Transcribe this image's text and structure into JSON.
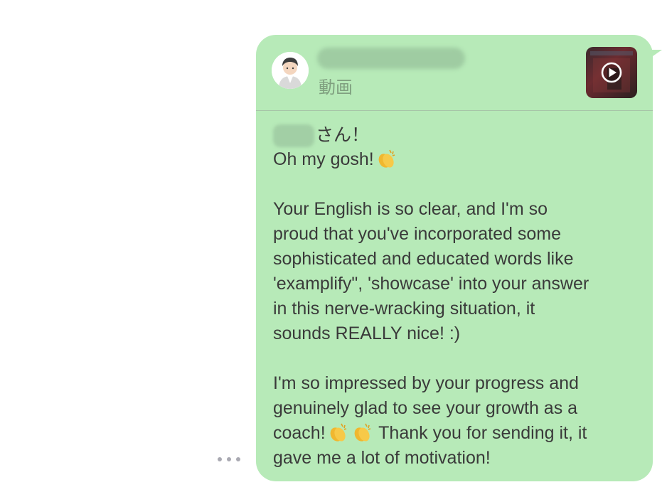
{
  "reply_preview": {
    "media_type_label": "動画",
    "icons": {
      "avatar": "person-avatar-icon",
      "thumbnail": "video-thumbnail",
      "play": "play-icon"
    }
  },
  "message": {
    "greeting_suffix": "さん！",
    "lines": [
      "Oh my gosh!",
      "",
      "Your English is so clear, and I'm so",
      "proud that you've incorporated some",
      "sophisticated and educated words like",
      "'examplify\", 'showcase' into your answer",
      "in this nerve-wracking situation, it",
      "sounds REALLY nice! :)",
      "",
      "I'm so impressed by your progress and",
      "genuinely glad to see your growth as a",
      "coach!",
      " Thank you for sending it, it",
      "gave me a lot of motivation!"
    ],
    "icons": {
      "clap": "clapping-hands-icon",
      "more": "more-dots-icon"
    }
  },
  "colors": {
    "bubble": "#b7eab8",
    "text": "#3a3a3a",
    "secondary_text": "#7f9f7f"
  }
}
